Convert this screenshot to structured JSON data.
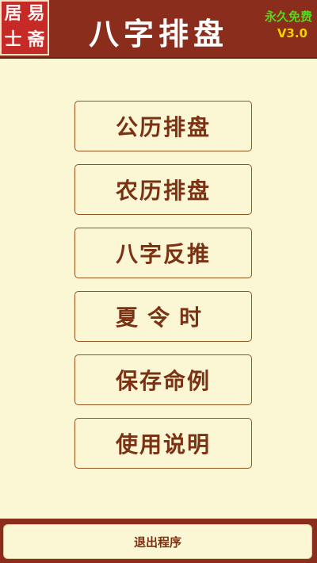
{
  "header": {
    "seal_chars": [
      "居",
      "易",
      "士",
      "斋"
    ],
    "title": "八字排盘",
    "free_label": "永久免费",
    "version": "V3.0"
  },
  "menu": {
    "items": [
      {
        "label": "公历排盘"
      },
      {
        "label": "农历排盘"
      },
      {
        "label": "八字反推"
      },
      {
        "label": "夏令时"
      },
      {
        "label": "保存命例"
      },
      {
        "label": "使用说明"
      }
    ]
  },
  "footer": {
    "exit_label": "退出程序"
  }
}
